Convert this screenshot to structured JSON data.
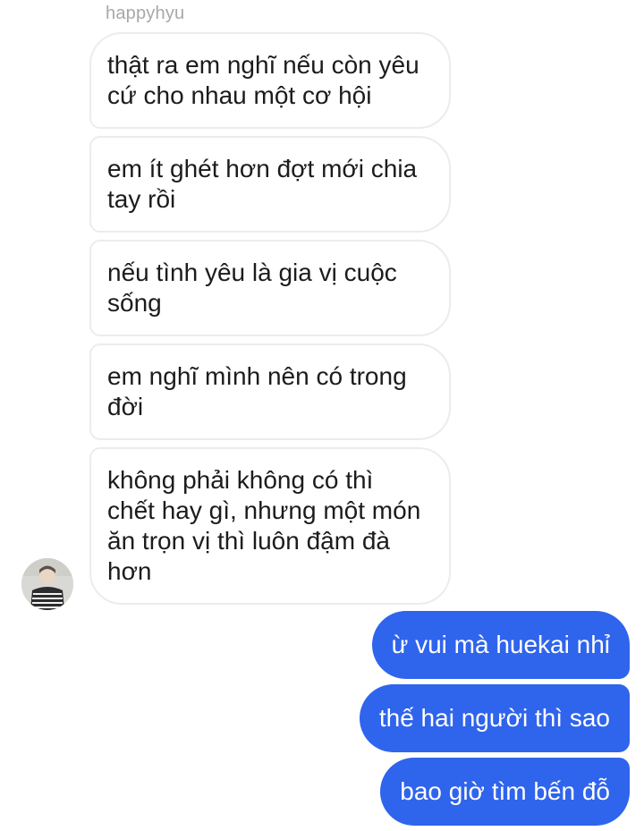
{
  "chat": {
    "sender_name": "happyhyu",
    "incoming_messages": [
      "thật ra em nghĩ nếu còn yêu\ncứ cho nhau một cơ hội",
      "em ít ghét hơn đợt mới chia\ntay rồi",
      "nếu tình yêu là gia vị cuộc\nsống",
      "em nghĩ mình nên có trong\nđời",
      "không phải không có thì\nchết hay gì, nhưng một món\năn trọn vị thì luôn đậm đà\nhơn"
    ],
    "outgoing_messages": [
      "ừ vui mà huekai nhỉ",
      "thế hai người thì sao",
      "bao giờ tìm bến đỗ"
    ]
  },
  "colors": {
    "outgoing_bubble": "#2f64ec",
    "incoming_border": "#ececec",
    "sender_name": "#a8a8a8"
  },
  "icons": {
    "avatar": "contact-avatar"
  }
}
